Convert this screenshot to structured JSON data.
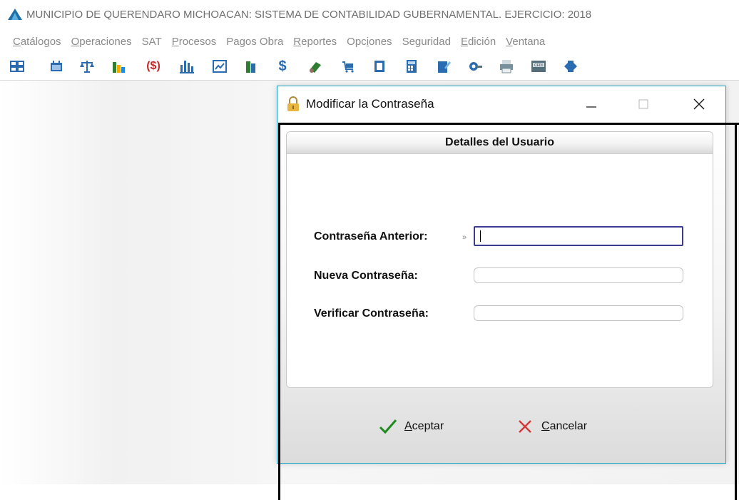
{
  "app": {
    "title": "MUNICIPIO DE QUERENDARO MICHOACAN: SISTEMA DE CONTABILIDAD GUBERNAMENTAL. EJERCICIO: 2018",
    "menu": [
      {
        "first": "C",
        "rest": "atálogos"
      },
      {
        "first": "O",
        "rest": "peraciones"
      },
      {
        "first": "",
        "rest": "SAT"
      },
      {
        "first": "P",
        "rest": "rocesos"
      },
      {
        "first": "",
        "rest": "Pagos Obra"
      },
      {
        "first": "R",
        "rest": "eportes"
      },
      {
        "pre": "Opc",
        "first": "i",
        "rest": "ones"
      },
      {
        "first": "",
        "rest": "Seguridad"
      },
      {
        "first": "E",
        "rest": "dición"
      },
      {
        "first": "V",
        "rest": "entana"
      }
    ],
    "toolbar_icons": [
      "grid-icon",
      "calendar-icon",
      "balance-scale-icon",
      "bar-chart-icon",
      "money-bag-icon",
      "columns-chart-icon",
      "line-chart-icon",
      "books-icon",
      "dollar-icon",
      "money-hand-icon",
      "cart-icon",
      "document-icon",
      "calculator-icon",
      "edit-document-icon",
      "tools-icon",
      "printer-icon",
      "cfdi-icon",
      "exit-icon"
    ]
  },
  "dialog": {
    "title": "Modificar la Contraseña",
    "panel_title": "Detalles del Usuario",
    "fields": [
      {
        "label": "Contraseña Anterior:",
        "value": "",
        "placeholder": ""
      },
      {
        "label": "Nueva Contraseña:",
        "value": "",
        "placeholder": ""
      },
      {
        "label": "Verificar Contraseña:",
        "value": "",
        "placeholder": ""
      }
    ],
    "accept": {
      "first": "A",
      "rest": "ceptar"
    },
    "cancel": {
      "first": "C",
      "rest": "ancelar"
    }
  },
  "colors": {
    "dialog_border": "#1aa7c7",
    "accept_check": "#1f8a1f",
    "cancel_x": "#d63a3a"
  }
}
